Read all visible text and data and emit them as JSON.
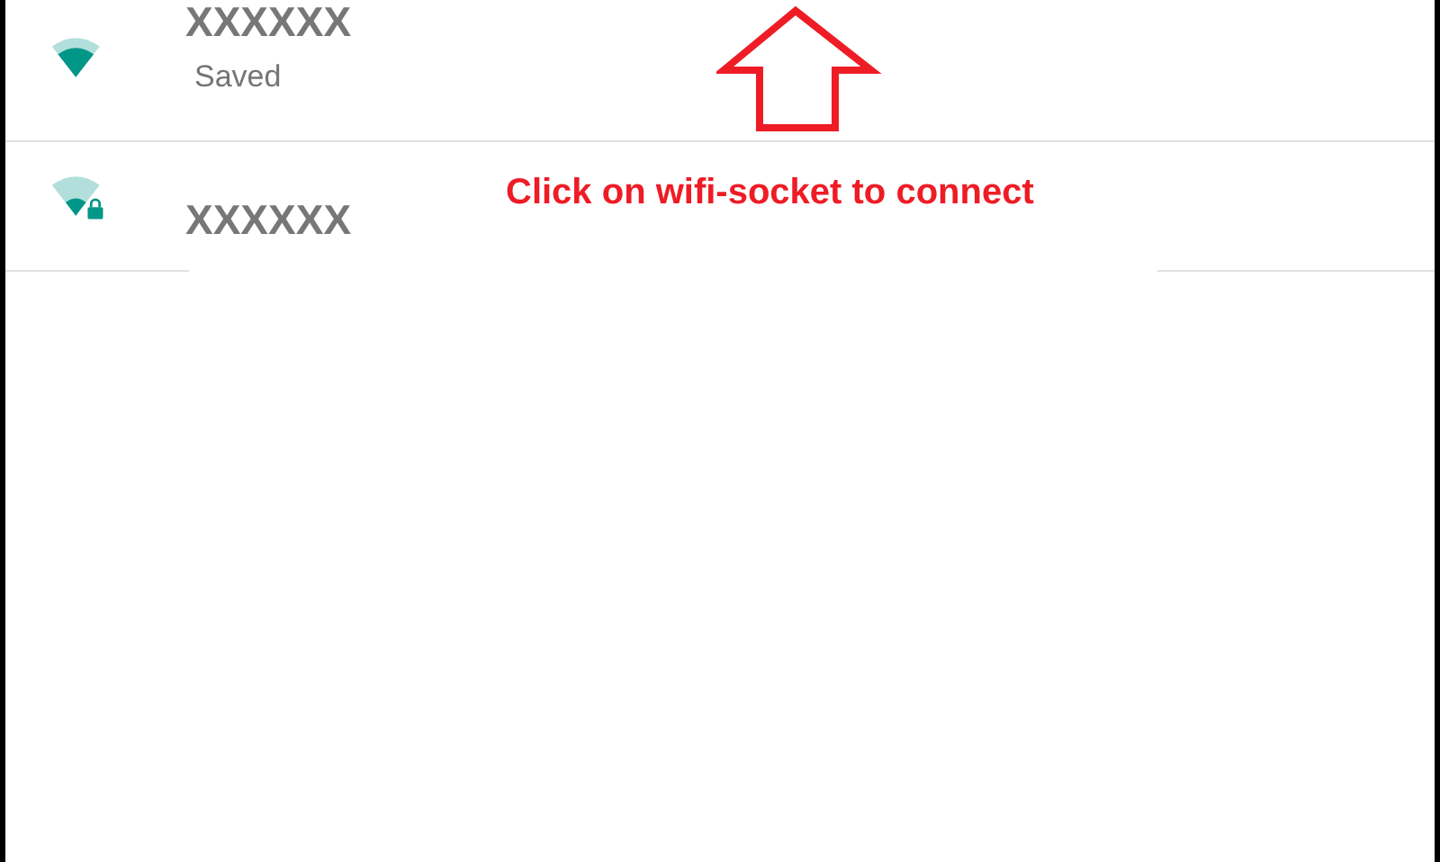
{
  "networks": [
    {
      "name": "XXXXXX",
      "status": "Saved",
      "kind": "strong",
      "secured": false
    },
    {
      "name": "XXXXXX",
      "kind": "medium",
      "secured": true
    }
  ],
  "annotation": {
    "text": "Click on wifi-socket to connect"
  }
}
